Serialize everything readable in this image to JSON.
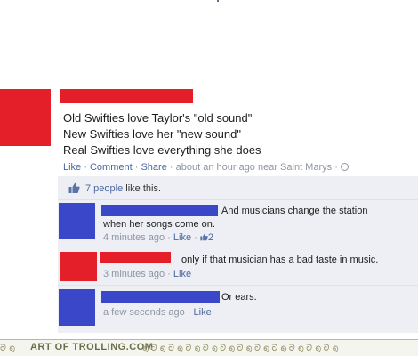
{
  "post": {
    "lines": [
      "Old Swifties love Taylor's \"old sound\"",
      "New Swifties love her \"new sound\"",
      "Real Swifties love everything she does"
    ],
    "actions": {
      "like": "Like",
      "comment": "Comment",
      "share": "Share",
      "time": "about an hour ago near Saint Marys"
    }
  },
  "likes": {
    "count_text": "7 people",
    "suffix": "like this."
  },
  "comments": [
    {
      "line1": "And musicians change the station",
      "line2": "when her songs come on.",
      "time": "4 minutes ago",
      "like": "Like",
      "like_count": "2",
      "avatar_color": "#3b47c9",
      "name_color": "#3b47c9"
    },
    {
      "line1": "only if that musician has a bad taste in music.",
      "time": "3 minutes ago",
      "like": "Like",
      "avatar_color": "#e41f2a",
      "name_color": "#e41f2a"
    },
    {
      "line1": "Or ears.",
      "time": "a few seconds ago",
      "like": "Like",
      "avatar_color": "#3b47c9",
      "name_color": "#3b47c9"
    }
  ],
  "footer": {
    "watermark": "ART OF TROLLING.COM"
  },
  "colors": {
    "red": "#e41f2a",
    "blue": "#3b47c9",
    "link": "#4b67a1"
  }
}
